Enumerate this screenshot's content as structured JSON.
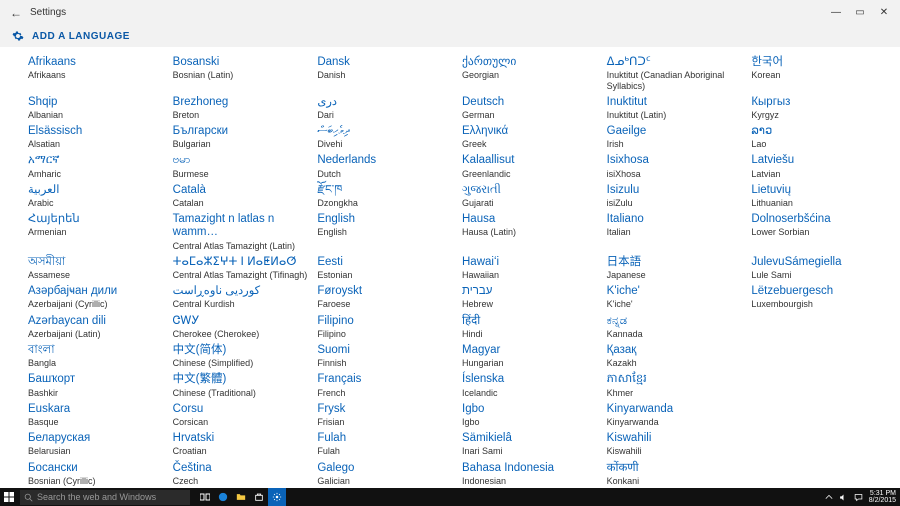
{
  "window": {
    "title": "Settings",
    "min": "—",
    "max": "▭",
    "close": "✕",
    "back": "←"
  },
  "page": {
    "title": "ADD A LANGUAGE"
  },
  "taskbar": {
    "search_placeholder": "Search the web and Windows",
    "time": "5:31 PM",
    "date": "8/2/2015"
  },
  "languages": [
    {
      "native": "Afrikaans",
      "eng": "Afrikaans"
    },
    {
      "native": "Shqip",
      "eng": "Albanian"
    },
    {
      "native": "Elsässisch",
      "eng": "Alsatian"
    },
    {
      "native": "አማርኛ",
      "eng": "Amharic"
    },
    {
      "native": "العربية",
      "eng": "Arabic"
    },
    {
      "native": "Հայերեն",
      "eng": "Armenian"
    },
    {
      "native": "অসমীয়া",
      "eng": "Assamese"
    },
    {
      "native": "Азәрбајҹан дили",
      "eng": "Azerbaijani (Cyrillic)"
    },
    {
      "native": "Azərbaycan dili",
      "eng": "Azerbaijani (Latin)"
    },
    {
      "native": "বাংলা",
      "eng": "Bangla"
    },
    {
      "native": "Башҡорт",
      "eng": "Bashkir"
    },
    {
      "native": "Euskara",
      "eng": "Basque"
    },
    {
      "native": "Беларуская",
      "eng": "Belarusian"
    },
    {
      "native": "Босански",
      "eng": "Bosnian (Cyrillic)"
    },
    {
      "native": "Bosanski",
      "eng": "Bosnian (Latin)"
    },
    {
      "native": "Brezhoneg",
      "eng": "Breton"
    },
    {
      "native": "Български",
      "eng": "Bulgarian"
    },
    {
      "native": "ဗမာ",
      "eng": "Burmese"
    },
    {
      "native": "Català",
      "eng": "Catalan"
    },
    {
      "native": "Tamazight n latlas n wamm…",
      "eng": "Central Atlas Tamazight (Latin)"
    },
    {
      "native": "ⵜⴰⵎⴰⵣⵉⵖⵜ ⵏ ⵍⴰⵟⵍⴰⵚ",
      "eng": "Central Atlas Tamazight (Tifinagh)"
    },
    {
      "native": "کوردیی ناوەڕاست",
      "eng": "Central Kurdish"
    },
    {
      "native": "ᏣᎳᎩ",
      "eng": "Cherokee (Cherokee)"
    },
    {
      "native": "中文(简体)",
      "eng": "Chinese (Simplified)"
    },
    {
      "native": "中文(繁體)",
      "eng": "Chinese (Traditional)"
    },
    {
      "native": "Corsu",
      "eng": "Corsican"
    },
    {
      "native": "Hrvatski",
      "eng": "Croatian"
    },
    {
      "native": "Čeština",
      "eng": "Czech"
    },
    {
      "native": "Dansk",
      "eng": "Danish"
    },
    {
      "native": "درى",
      "eng": "Dari"
    },
    {
      "native": "ދިވެހިބަސް",
      "eng": "Divehi"
    },
    {
      "native": "Nederlands",
      "eng": "Dutch"
    },
    {
      "native": "རྫོང་ཁ",
      "eng": "Dzongkha"
    },
    {
      "native": "English",
      "eng": "English"
    },
    {
      "native": "Eesti",
      "eng": "Estonian"
    },
    {
      "native": "Føroyskt",
      "eng": "Faroese"
    },
    {
      "native": "Filipino",
      "eng": "Filipino"
    },
    {
      "native": "Suomi",
      "eng": "Finnish"
    },
    {
      "native": "Français",
      "eng": "French"
    },
    {
      "native": "Frysk",
      "eng": "Frisian"
    },
    {
      "native": "Fulah",
      "eng": "Fulah"
    },
    {
      "native": "Galego",
      "eng": "Galician"
    },
    {
      "native": "ქართული",
      "eng": "Georgian"
    },
    {
      "native": "Deutsch",
      "eng": "German"
    },
    {
      "native": "Ελληνικά",
      "eng": "Greek"
    },
    {
      "native": "Kalaallisut",
      "eng": "Greenlandic"
    },
    {
      "native": "ગુજરાતી",
      "eng": "Gujarati"
    },
    {
      "native": "Hausa",
      "eng": "Hausa (Latin)"
    },
    {
      "native": "Hawaiʻi",
      "eng": "Hawaiian"
    },
    {
      "native": "עברית",
      "eng": "Hebrew"
    },
    {
      "native": "हिंदी",
      "eng": "Hindi"
    },
    {
      "native": "Magyar",
      "eng": "Hungarian"
    },
    {
      "native": "Íslenska",
      "eng": "Icelandic"
    },
    {
      "native": "Igbo",
      "eng": "Igbo"
    },
    {
      "native": "Sämikielâ",
      "eng": "Inari Sami"
    },
    {
      "native": "Bahasa Indonesia",
      "eng": "Indonesian"
    },
    {
      "native": "ᐃᓄᒃᑎᑐᑦ",
      "eng": "Inuktitut (Canadian Aboriginal Syllabics)"
    },
    {
      "native": "Inuktitut",
      "eng": "Inuktitut (Latin)"
    },
    {
      "native": "Gaeilge",
      "eng": "Irish"
    },
    {
      "native": "Isixhosa",
      "eng": "isiXhosa"
    },
    {
      "native": "Isizulu",
      "eng": "isiZulu"
    },
    {
      "native": "Italiano",
      "eng": "Italian"
    },
    {
      "native": "日本語",
      "eng": "Japanese"
    },
    {
      "native": "K'iche'",
      "eng": "K'iche'"
    },
    {
      "native": "ಕನ್ನಡ",
      "eng": "Kannada"
    },
    {
      "native": "Қазақ",
      "eng": "Kazakh"
    },
    {
      "native": "ភាសាខ្មែរ",
      "eng": "Khmer"
    },
    {
      "native": "Kinyarwanda",
      "eng": "Kinyarwanda"
    },
    {
      "native": "Kiswahili",
      "eng": "Kiswahili"
    },
    {
      "native": "कोंकणी",
      "eng": "Konkani"
    },
    {
      "native": "한국어",
      "eng": "Korean"
    },
    {
      "native": "Кыргыз",
      "eng": "Kyrgyz"
    },
    {
      "native": "ລາວ",
      "eng": "Lao"
    },
    {
      "native": "Latviešu",
      "eng": "Latvian"
    },
    {
      "native": "Lietuvių",
      "eng": "Lithuanian"
    },
    {
      "native": "Dolnoserbšćina",
      "eng": "Lower Sorbian"
    },
    {
      "native": "JulevuSámegiella",
      "eng": "Lule Sami"
    },
    {
      "native": "Lëtzebuergesch",
      "eng": "Luxembourgish"
    }
  ]
}
